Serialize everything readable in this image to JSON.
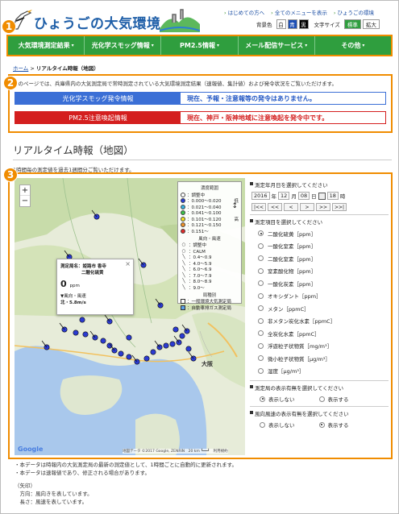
{
  "header": {
    "logo_text": "ひょうごの大気環境",
    "top_links": [
      "はじめての方へ",
      "全てのメニューを表示",
      "ひょうごの環境"
    ],
    "color_label": "背景色",
    "color_options": [
      "白",
      "青",
      "黒"
    ],
    "font_label": "文字サイズ",
    "font_options": [
      "標準",
      "拡大"
    ]
  },
  "nav": {
    "items": [
      "大気環境測定結果",
      "光化学スモッグ情報",
      "PM2.5情報",
      "メール配信サービス",
      "その他"
    ]
  },
  "badges": [
    "1",
    "2",
    "3"
  ],
  "breadcrumb": {
    "home": "ホーム",
    "sep": ">",
    "current": "リアルタイム時報（地図）"
  },
  "intro": "このページでは、兵庫県内の大気測定局で常時測定されている大気環境測定結果（速報値、集計値）および発令状況をご覧いただけます。",
  "alerts": [
    {
      "label": "光化学スモッグ発令情報",
      "message": "現在、予報・注意報等の発令はありません。",
      "label_bg": "#3b6fd6",
      "border": "#3b6fd6",
      "text_color": "#2257c4"
    },
    {
      "label": "PM2.5注意喚起情報",
      "message": "現在、神戸・阪神地域に注意喚起を発令中です。",
      "label_bg": "#d41f1f",
      "border": "#d41f1f",
      "text_color": "#d41f1f"
    }
  ],
  "page_title": "リアルタイム時報（地図）",
  "subtitle": "1時間毎の測定値を過去1週間分ご覧いただけます。",
  "map": {
    "zoom_in": "+",
    "zoom_out": "−",
    "google": "Google",
    "attribution": "地図データ ©2017 Google, ZENRIN　20 km ┗━━┛　利用規約",
    "city_label": "大阪",
    "popup": {
      "station": "測定局名：姫路市 香寺",
      "item": "二酸化硫黄",
      "value": "0",
      "unit": "ppm",
      "wind_label": "▼風向・風速",
      "wind_value": "北・5.8m/s",
      "close": "×"
    },
    "legend": {
      "conc_title": "濃度範囲",
      "conc_rows": [
        {
          "label": "：調整中",
          "color": "#ffffff"
        },
        {
          "label": "：0.000～0.020",
          "color": "#2a3fd6"
        },
        {
          "label": "：0.021～0.040",
          "color": "#36b3e0"
        },
        {
          "label": "：0.041～0.100",
          "color": "#3cc24a"
        },
        {
          "label": "：0.101～0.120",
          "color": "#f0e020"
        },
        {
          "label": "：0.121～0.150",
          "color": "#f0922a"
        },
        {
          "label": "：0.151～",
          "color": "#e02a2a"
        }
      ],
      "low": "低",
      "high": "高",
      "wind_title": "風向・風速",
      "wind_rows": [
        {
          "label": "：調整中",
          "sym": "○"
        },
        {
          "label": "：CALM",
          "sym": "○"
        },
        {
          "label": "：0.4～0.9",
          "sym": "╲"
        },
        {
          "label": "：4.0～5.9",
          "sym": "╲"
        },
        {
          "label": "：6.0～6.9",
          "sym": "╲"
        },
        {
          "label": "：7.0～7.9",
          "sym": "╲"
        },
        {
          "label": "：8.0～8.9",
          "sym": "╲"
        },
        {
          "label": "：9.0～",
          "sym": "╲"
        }
      ],
      "type_title": "局種別",
      "type_rows": [
        {
          "label": "：一般環境大気測定局",
          "color": "#ffffff"
        },
        {
          "label": "：自動車排ガス測定局",
          "color": "#5aa0e8"
        }
      ]
    }
  },
  "side": {
    "date_title": "測定年月日を選択してください",
    "year": "2016",
    "year_unit": "年",
    "month": "12",
    "month_unit": "月",
    "day": "08",
    "day_unit": "日",
    "hour": "18",
    "hour_unit": "時",
    "nav_buttons": [
      "|<<",
      "<<",
      "<",
      ">",
      ">>",
      ">>|"
    ],
    "item_title": "測定項目を選択してください",
    "items": [
      "二酸化硫黄［ppm］",
      "一酸化窒素［ppm］",
      "二酸化窒素［ppm］",
      "窒素酸化物［ppm］",
      "一酸化炭素［ppm］",
      "オキシダント［ppm］",
      "メタン［ppmC］",
      "非メタン炭化水素［ppmC］",
      "全炭化水素［ppmC］",
      "浮遊粒子状物質［mg/m³］",
      "微小粒子状物質［μg/m³］",
      "湿度［μg/m³］"
    ],
    "selected_item": 0,
    "station_title": "測定局の表示有無を選択してください",
    "station_options": [
      "表示しない",
      "表示する"
    ],
    "station_selected": 0,
    "wind_title": "風向風速の表示有無を選択してください",
    "wind_options": [
      "表示しない",
      "表示する"
    ],
    "wind_selected": 1
  },
  "notes": [
    "・本データは時報内の大気測定局の最新の測定値として、1時間ごとに自動的に更新されます。",
    "・本データは速報値であり、修正される場合があります。",
    "",
    "（矢印）",
    "　方向：風向きを表しています。",
    "　長さ：風速を表しています。"
  ]
}
